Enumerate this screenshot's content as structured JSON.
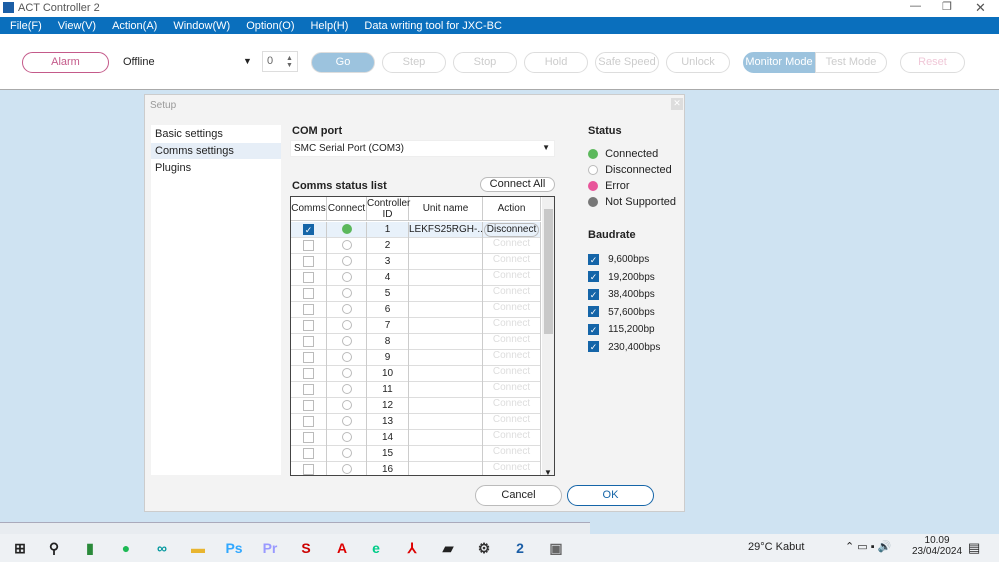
{
  "app": {
    "title": "ACT Controller 2"
  },
  "menu": [
    "File(F)",
    "View(V)",
    "Action(A)",
    "Window(W)",
    "Option(O)",
    "Help(H)",
    "Data writing tool for JXC-BC"
  ],
  "toolbar": {
    "alarm": "Alarm",
    "mode_select": "Offline",
    "step_value": "0",
    "buttons": [
      "Go",
      "Step",
      "Stop",
      "Hold",
      "Safe Speed",
      "Unlock"
    ],
    "monitor_mode": "Monitor Mode",
    "test_mode": "Test Mode",
    "reset": "Reset"
  },
  "setup": {
    "title": "Setup",
    "nav": [
      "Basic settings",
      "Comms settings",
      "Plugins"
    ],
    "selected_nav": "Comms settings",
    "com_port_label": "COM port",
    "com_port_value": "SMC Serial Port (COM3)",
    "list_label": "Comms status list",
    "connect_all": "Connect All",
    "columns": [
      "Comms",
      "Connect",
      "Controller ID",
      "Unit name",
      "Action"
    ],
    "rows": [
      {
        "comms": true,
        "status": "connected",
        "id": "1",
        "unit": "LEKFS25RGH-...",
        "action": "Disconnect"
      },
      {
        "comms": false,
        "status": "disconnected",
        "id": "2",
        "unit": "",
        "action": "Connect"
      },
      {
        "comms": false,
        "status": "disconnected",
        "id": "3",
        "unit": "",
        "action": "Connect"
      },
      {
        "comms": false,
        "status": "disconnected",
        "id": "4",
        "unit": "",
        "action": "Connect"
      },
      {
        "comms": false,
        "status": "disconnected",
        "id": "5",
        "unit": "",
        "action": "Connect"
      },
      {
        "comms": false,
        "status": "disconnected",
        "id": "6",
        "unit": "",
        "action": "Connect"
      },
      {
        "comms": false,
        "status": "disconnected",
        "id": "7",
        "unit": "",
        "action": "Connect"
      },
      {
        "comms": false,
        "status": "disconnected",
        "id": "8",
        "unit": "",
        "action": "Connect"
      },
      {
        "comms": false,
        "status": "disconnected",
        "id": "9",
        "unit": "",
        "action": "Connect"
      },
      {
        "comms": false,
        "status": "disconnected",
        "id": "10",
        "unit": "",
        "action": "Connect"
      },
      {
        "comms": false,
        "status": "disconnected",
        "id": "11",
        "unit": "",
        "action": "Connect"
      },
      {
        "comms": false,
        "status": "disconnected",
        "id": "12",
        "unit": "",
        "action": "Connect"
      },
      {
        "comms": false,
        "status": "disconnected",
        "id": "13",
        "unit": "",
        "action": "Connect"
      },
      {
        "comms": false,
        "status": "disconnected",
        "id": "14",
        "unit": "",
        "action": "Connect"
      },
      {
        "comms": false,
        "status": "disconnected",
        "id": "15",
        "unit": "",
        "action": "Connect"
      },
      {
        "comms": false,
        "status": "disconnected",
        "id": "16",
        "unit": "",
        "action": "Connect"
      }
    ],
    "status_label": "Status",
    "legend": [
      {
        "label": "Connected",
        "color": "#5cb85c"
      },
      {
        "label": "Disconnected",
        "color": "#ffffff"
      },
      {
        "label": "Error",
        "color": "#e8559a"
      },
      {
        "label": "Not Supported",
        "color": "#777777"
      }
    ],
    "baudrate_label": "Baudrate",
    "baudrates": [
      {
        "label": "9,600bps",
        "checked": true
      },
      {
        "label": "19,200bps",
        "checked": true
      },
      {
        "label": "38,400bps",
        "checked": true
      },
      {
        "label": "57,600bps",
        "checked": true
      },
      {
        "label": "115,200bp",
        "checked": true
      },
      {
        "label": "230,400bps",
        "checked": true
      }
    ],
    "cancel": "Cancel",
    "ok": "OK"
  },
  "taskbar": {
    "weather": "29°C  Kabut",
    "time": "10.09",
    "date": "23/04/2024"
  },
  "colors": {
    "menubar": "#0a6fbd",
    "accent": "#1565a8",
    "monitor_mode": "#9cc3de"
  }
}
